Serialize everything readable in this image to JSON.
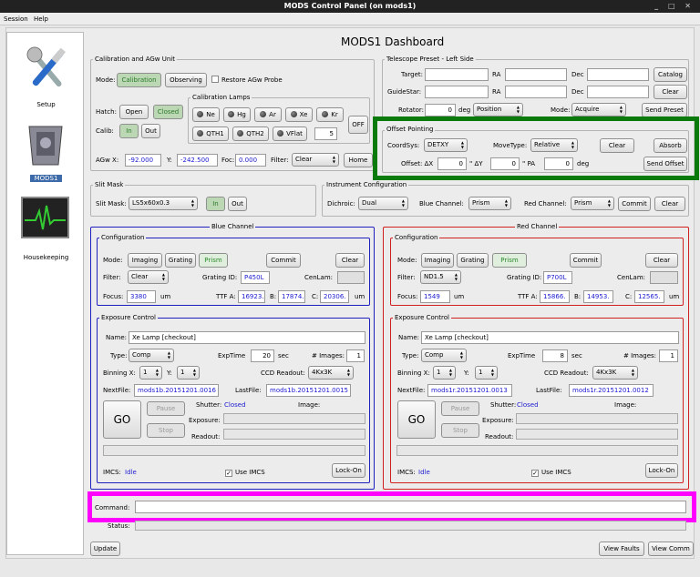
{
  "window": {
    "title": "MODS Control Panel (on mods1)",
    "controls": "_ □ ✕"
  },
  "menu": {
    "session": "Session",
    "help": "Help"
  },
  "sidebar": {
    "setup": "Setup",
    "mods1": "MODS1",
    "housekeeping": "Housekeeping"
  },
  "dashboard_title": "MODS1 Dashboard",
  "cal": {
    "legend": "Calibration and AGw Unit",
    "mode_label": "Mode:",
    "mode_cal": "Calibration",
    "mode_obs": "Observing",
    "restore": "Restore AGw Probe",
    "hatch_label": "Hatch:",
    "open": "Open",
    "closed": "Closed",
    "calib_label": "Calib:",
    "in": "In",
    "out": "Out",
    "lamps_legend": "Calibration Lamps",
    "lamp_ne": "Ne",
    "lamp_hg": "Hg",
    "lamp_ar": "Ar",
    "lamp_xe": "Xe",
    "lamp_kr": "Kr",
    "lamp_qth1": "QTH1",
    "lamp_qth2": "QTH2",
    "lamp_vflat": "VFlat",
    "off": "OFF",
    "vflat_value": "5",
    "agwx_label": "AGw X:",
    "agwx": "-92.000",
    "y_label": "Y:",
    "agwy": "-242.500",
    "foc_label": "Foc:",
    "foc": "0.000",
    "filter_label": "Filter:",
    "filter": "Clear",
    "home": "Home"
  },
  "tel": {
    "legend": "Telescope Preset - Left Side",
    "target_label": "Target:",
    "ra_label": "RA",
    "dec_label": "Dec",
    "catalog": "Catalog",
    "guidestar_label": "GuideStar:",
    "clear": "Clear",
    "rotator_label": "Rotator:",
    "rotator": "0",
    "deg": "deg",
    "rotmode": "Position",
    "mode_label": "Mode:",
    "mode": "Acquire",
    "send_preset": "Send Preset"
  },
  "offset": {
    "legend": "Offset Pointing",
    "coordsys_label": "CoordSys:",
    "coordsys": "DETXY",
    "movetype_label": "MoveType:",
    "movetype": "Relative",
    "clear": "Clear",
    "absorb": "Absorb",
    "offset_label": "Offset: ΔX",
    "dx": "0",
    "dy_label": "\" ΔY",
    "dy": "0",
    "pa_label": "\" PA",
    "pa": "0",
    "deg": "deg",
    "send": "Send Offset"
  },
  "slit": {
    "legend": "Slit Mask",
    "label": "Slit Mask:",
    "value": "LS5x60x0.3",
    "in": "In",
    "out": "Out"
  },
  "inst": {
    "legend": "Instrument Configuration",
    "dichroic_label": "Dichroic:",
    "dichroic": "Dual",
    "blue_label": "Blue Channel:",
    "blue": "Prism",
    "red_label": "Red Channel:",
    "red": "Prism",
    "commit": "Commit",
    "clear": "Clear"
  },
  "blue": {
    "title": "Blue Channel",
    "config_legend": "Configuration",
    "mode_label": "Mode:",
    "imaging": "Imaging",
    "grating": "Grating",
    "prism": "Prism",
    "commit": "Commit",
    "clear": "Clear",
    "filter_label": "Filter:",
    "filter": "Clear",
    "gratingid_label": "Grating ID:",
    "gratingid": "P450L",
    "cenlam_label": "CenLam:",
    "cenlam": "",
    "focus_label": "Focus:",
    "focus": "3380",
    "um": "um",
    "ttfa_label": "TTF A:",
    "ttfa": "16923.",
    "b_label": "B:",
    "ttfb": "17874.",
    "c_label": "C:",
    "ttfc": "20306.",
    "um2": "um",
    "exp_legend": "Exposure Control",
    "name_label": "Name:",
    "name": "Xe Lamp [checkout]",
    "type_label": "Type:",
    "type": "Comp",
    "exptime_label": "ExpTime",
    "exptime": "20",
    "sec": "sec",
    "nimages_label": "# Images:",
    "nimages": "1",
    "binning_label": "Binning X:",
    "binx": "1",
    "biny_label": "Y:",
    "biny": "1",
    "ccd_label": "CCD Readout:",
    "ccd": "4Kx3K",
    "nextfile_label": "NextFile:",
    "nextfile": "mods1b.20151201.0016",
    "lastfile_label": "LastFile:",
    "lastfile": "mods1b.20151201.0015",
    "go": "GO",
    "pause": "Pause",
    "stop": "Stop",
    "shutter_label": "Shutter:",
    "shutter": "Closed",
    "image_label": "Image:",
    "exposure_label": "Exposure:",
    "readout_label": "Readout:",
    "imcs_label": "IMCS:",
    "imcs": "Idle",
    "use_imcs": "Use IMCS",
    "lockon": "Lock-On"
  },
  "red": {
    "title": "Red Channel",
    "config_legend": "Configuration",
    "mode_label": "Mode:",
    "imaging": "Imaging",
    "grating": "Grating",
    "prism": "Prism",
    "commit": "Commit",
    "clear": "Clear",
    "filter_label": "Filter:",
    "filter": "ND1.5",
    "gratingid_label": "Grating ID:",
    "gratingid": "P700L",
    "cenlam_label": "CenLam:",
    "cenlam": "",
    "focus_label": "Focus:",
    "focus": "1549",
    "um": "um",
    "ttfa_label": "TTF A:",
    "ttfa": "15866.",
    "b_label": "B:",
    "ttfb": "14953.",
    "c_label": "C:",
    "ttfc": "12565.",
    "um2": "um",
    "exp_legend": "Exposure Control",
    "name_label": "Name:",
    "name": "Xe Lamp [checkout]",
    "type_label": "Type:",
    "type": "Comp",
    "exptime_label": "ExpTime",
    "exptime": "8",
    "sec": "sec",
    "nimages_label": "# Images:",
    "nimages": "1",
    "binning_label": "Binning X:",
    "binx": "1",
    "biny_label": "Y:",
    "biny": "1",
    "ccd_label": "CCD Readout:",
    "ccd": "4Kx3K",
    "nextfile_label": "NextFile:",
    "nextfile": "mods1r.20151201.0013",
    "lastfile_label": "LastFile:",
    "lastfile": "mods1r.20151201.0012",
    "go": "GO",
    "pause": "Pause",
    "stop": "Stop",
    "shutter_label": "Shutter:",
    "shutter": "Closed",
    "image_label": "Image:",
    "exposure_label": "Exposure:",
    "readout_label": "Readout:",
    "imcs_label": "IMCS:",
    "imcs": "Idle",
    "use_imcs": "Use IMCS",
    "lockon": "Lock-On"
  },
  "command": {
    "label": "Command:",
    "value": "",
    "status_label": "Status:",
    "status": ""
  },
  "footer": {
    "update": "Update",
    "view_faults": "View Faults",
    "view_comm": "View Comm"
  },
  "colors": {
    "highlight_green": "#0a7a0a",
    "highlight_magenta": "#ff00ff",
    "blue_border": "#2020c0",
    "red_border": "#d02020"
  }
}
